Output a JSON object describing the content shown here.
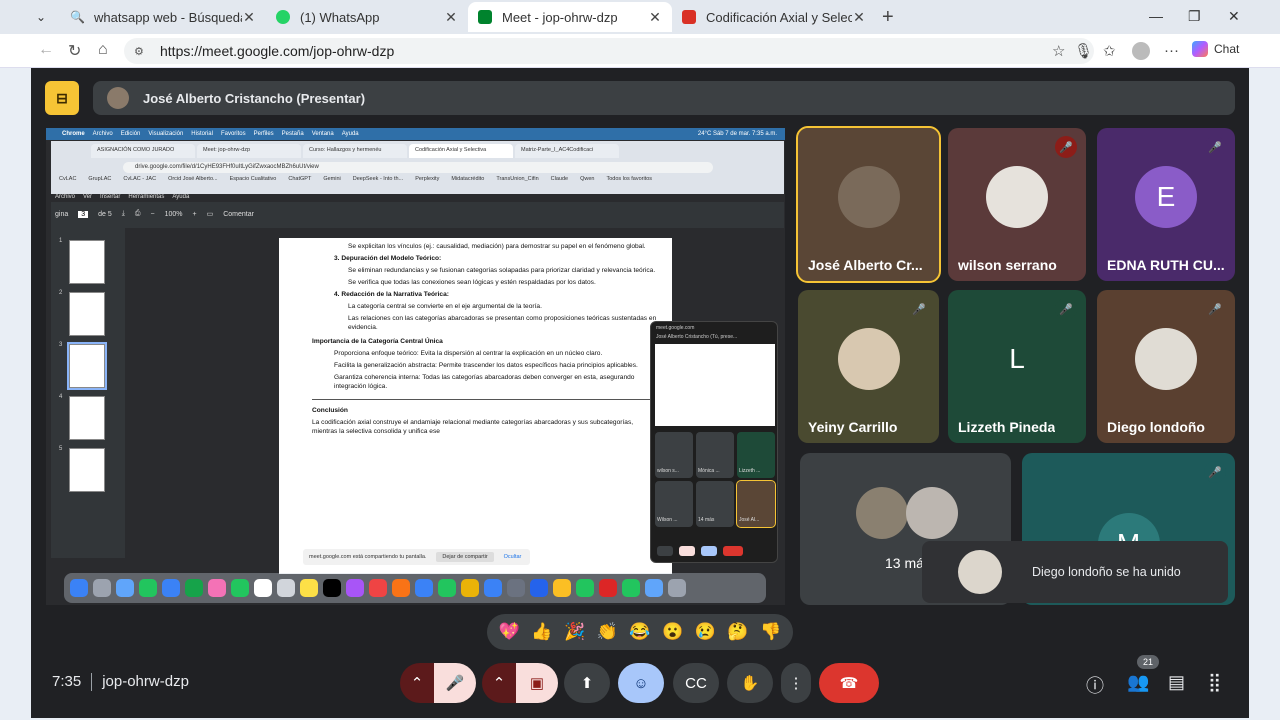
{
  "browser": {
    "tabs": [
      {
        "title": "whatsapp web - Búsqueda",
        "icon": "search-icon",
        "color": "#1a73e8"
      },
      {
        "title": "(1) WhatsApp",
        "icon": "whatsapp-icon",
        "color": "#25d366"
      },
      {
        "title": "Meet - jop-ohrw-dzp",
        "icon": "meet-icon",
        "color": "#00832d"
      },
      {
        "title": "Codificación Axial y Selectiva en la",
        "icon": "pdf-icon",
        "color": "#d93025"
      }
    ],
    "url": "https://meet.google.com/jop-ohrw-dzp",
    "chat_label": "Chat"
  },
  "meet": {
    "presenter": "José Alberto Cristancho (Presentar)",
    "time": "7:35",
    "code": "jop-ohrw-dzp",
    "participants_count": "21",
    "toast": "Diego londoño se ha unido",
    "reactions": [
      "💖",
      "👍",
      "🎉",
      "👏",
      "😂",
      "😮",
      "😢",
      "🤔",
      "👎"
    ],
    "participants": [
      {
        "name": "José Alberto Cr...",
        "muted": false,
        "bg": "#5a4636",
        "type": "photo",
        "avatar_color": "#7a6a5a"
      },
      {
        "name": "wilson serrano",
        "muted": true,
        "bg": "#5b3a3a",
        "type": "photo",
        "avatar_color": "#e6e2dc"
      },
      {
        "name": "EDNA RUTH CU...",
        "muted": true,
        "bg": "#4a2a6a",
        "type": "letter",
        "letter": "E",
        "avatar_color": "#8a5cc8"
      },
      {
        "name": "Yeiny Carrillo",
        "muted": true,
        "bg": "#4a4a30",
        "type": "photo",
        "avatar_color": "#d8c8b0"
      },
      {
        "name": "Lizzeth Pineda",
        "muted": true,
        "bg": "#1e4a38",
        "type": "letter",
        "letter": "L",
        "avatar_color": "#1e4a38"
      },
      {
        "name": "Diego londoño",
        "muted": true,
        "bg": "#5a4030",
        "type": "photo",
        "avatar_color": "#e0dcd4"
      }
    ],
    "more_label": "13 más",
    "m_tile": {
      "letter": "M",
      "bg": "#1d5a5a",
      "avatar_color": "#2c7a7a"
    }
  },
  "shared": {
    "menubar": [
      "Chrome",
      "Archivo",
      "Edición",
      "Visualización",
      "Historial",
      "Favoritos",
      "Perfiles",
      "Pestaña",
      "Ventana",
      "Ayuda"
    ],
    "menubar_right": "24°C   Sáb 7 de mar.  7:35 a.m.",
    "inner_tabs": [
      "ASIGNACIÓN COMO JURADO",
      "Meet: jop-ohrw-dzp",
      "Curso: Hallazgos y hermenéu",
      "Codificación Axial y Selectiva",
      "Matriz-Parte_I_AC4Codificaci"
    ],
    "inner_url": "drive.google.com/file/d/1CyHE93FHf0uItLyGifZwxaocMBZh6uUt/view",
    "bookmarks": [
      "CvLAC",
      "GrupLAC",
      "CvLAC - JAC",
      "Orcid José Alberto...",
      "Espacio Cualitativo",
      "ChatGPT",
      "Gemini",
      "DeepSeek - Into th...",
      "Perplexity",
      "Midatacrédito",
      "TransUnion_Cifin",
      "Claude",
      "Qwen",
      "Todos los favoritos"
    ],
    "pdf_menu": [
      "Archivo",
      "Ver",
      "Insertar",
      "Herramientas",
      "Ayuda"
    ],
    "pdf_page": "3",
    "pdf_of": "de 5",
    "pdf_zoom": "100%",
    "pdf_comment": "Comentar",
    "doc": {
      "p1": "Se explicitan los vínculos (ej.: causalidad, mediación) para demostrar su papel en el fenómeno global.",
      "h3": "3.  Depuración del Modelo Teórico:",
      "p2": "Se eliminan redundancias y se fusionan categorías solapadas para priorizar claridad y relevancia teórica.",
      "p3": "Se verifica que todas las conexiones sean lógicas y estén respaldadas por los datos.",
      "h4": "4.  Redacción de la Narrativa Teórica:",
      "p4": "La categoría central se convierte en el eje argumental de la teoría.",
      "p5": "Las relaciones con las categorías abarcadoras se presentan como proposiciones teóricas sustentadas en evidencia.",
      "hImp": "Importancia de la Categoría Central Única",
      "b1": "Proporciona enfoque teórico: Evita la dispersión al centrar la explicación en un núcleo claro.",
      "b2": "Facilita la generalización abstracta: Permite trascender los datos específicos hacia principios aplicables.",
      "b3": "Garantiza coherencia interna: Todas las categorías abarcadoras deben converger en esta, asegurando integración lógica.",
      "hConc": "Conclusión",
      "conc": "La codificación axial construye el andamiaje relacional mediante categorías abarcadoras y sus subcategorías, mientras la selectiva consolida y unifica ese"
    },
    "share_note": "meet.google.com está compartiendo tu pantalla.",
    "share_stop": "Dejar de compartir",
    "share_hide": "Ocultar",
    "pip_title": "meet.google.com",
    "pip_sub": "José Alberto Cristancho (Tú, prese...",
    "pip_names": [
      "wilson s...",
      "Mónica ...",
      "Lizzeth ...",
      "Wilson ...",
      "14 más",
      "José Al..."
    ]
  }
}
